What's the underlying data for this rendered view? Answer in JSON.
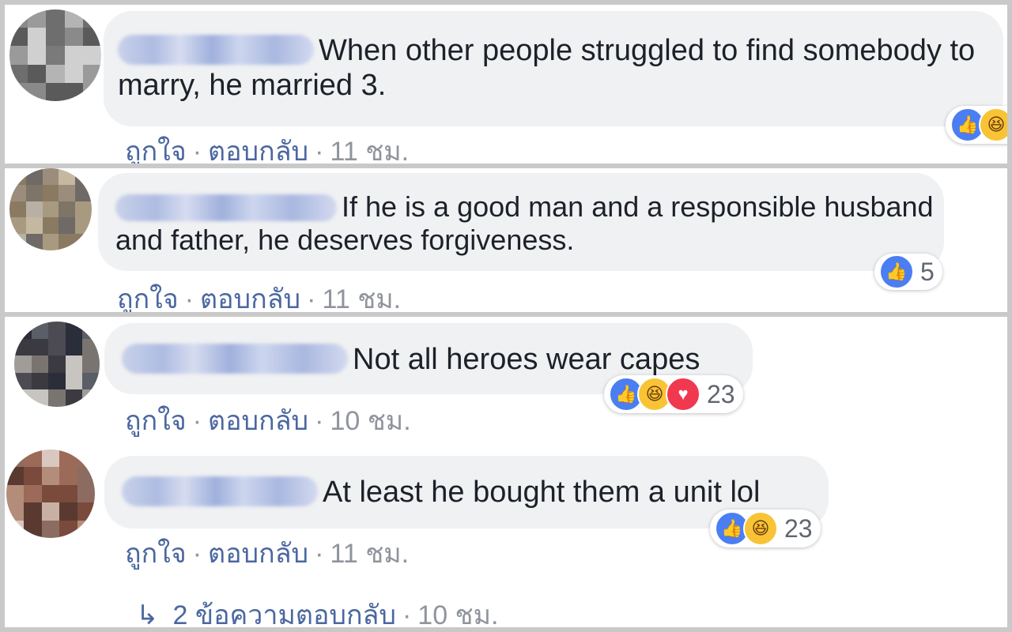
{
  "comments": [
    {
      "text": "When other people struggled to find somebody to marry, he married 3.",
      "actions": {
        "like": "ถูกใจ",
        "reply": "ตอบกลับ",
        "time": "11 ชม."
      },
      "reactions": {
        "icons": [
          "like-icon",
          "haha-icon"
        ],
        "count": ""
      }
    },
    {
      "text": "If he is a good man and a responsible husband and father, he deserves forgiveness.",
      "actions": {
        "like": "ถูกใจ",
        "reply": "ตอบกลับ",
        "time": "11 ชม."
      },
      "reactions": {
        "icons": [
          "like-icon"
        ],
        "count": "5"
      }
    },
    {
      "text": "Not all heroes wear capes",
      "actions": {
        "like": "ถูกใจ",
        "reply": "ตอบกลับ",
        "time": "10 ชม."
      },
      "reactions": {
        "icons": [
          "like-icon",
          "haha-icon",
          "love-icon"
        ],
        "count": "23"
      }
    },
    {
      "text": "At least he bought them a unit lol",
      "actions": {
        "like": "ถูกใจ",
        "reply": "ตอบกลับ",
        "time": "11 ชม."
      },
      "reactions": {
        "icons": [
          "like-icon",
          "haha-icon"
        ],
        "count": "23"
      },
      "replies": {
        "arrow": "↳",
        "label": "2 ข้อความตอบกลับ",
        "time": "10 ชม."
      }
    }
  ],
  "separator": "·",
  "colors": {
    "link": "#4b67a1",
    "muted": "#90949c",
    "bubble": "#f0f1f3",
    "like": "#4a7ef2",
    "haha": "#f8c436",
    "love": "#f0384f"
  }
}
